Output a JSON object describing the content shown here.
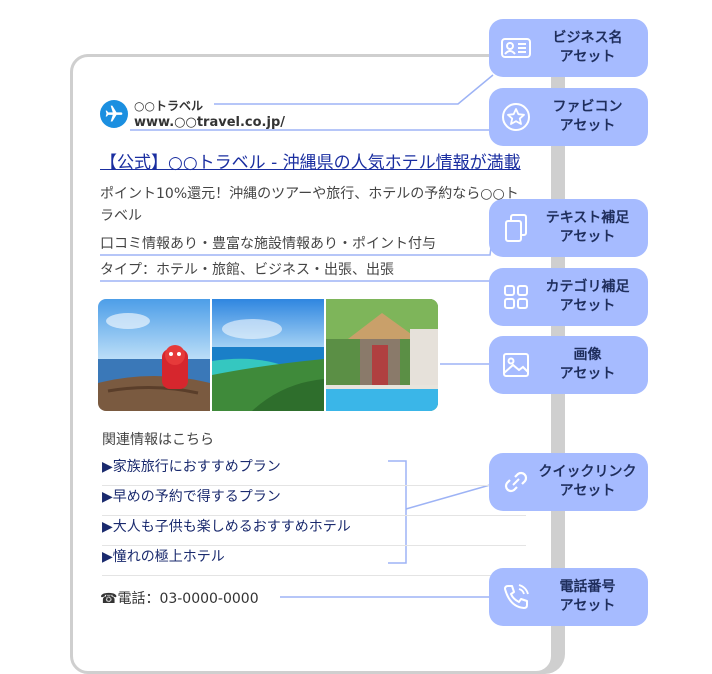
{
  "ad": {
    "business_name": "○○トラベル",
    "url": "www.○○travel.co.jp/",
    "headline": "【公式】○○トラベル - 沖縄県の人気ホテル情報が満載",
    "description": "ポイント10%還元！沖縄のツアーや旅行、ホテルの予約なら○○トラベル",
    "text_extension": "口コミ情報あり・豊富な施設情報あり・ポイント付与",
    "category_extension": "タイプ：ホテル・旅館、ビジネス・出張、出張",
    "related_heading": "関連情報はこちら",
    "quick_links": [
      "▶家族旅行におすすめプラン",
      "▶早めの予約で得するプラン",
      "▶大人も子供も楽しめるおすすめホテル",
      "▶憧れの極上ホテル"
    ],
    "phone": "☎電話：03-0000-0000"
  },
  "assets": [
    {
      "label": "ビジネス名\nアセット",
      "icon": "id-card-icon"
    },
    {
      "label": "ファビコン\nアセット",
      "icon": "star-icon"
    },
    {
      "label": "テキスト補足\nアセット",
      "icon": "copy-icon"
    },
    {
      "label": "カテゴリ補足\nアセット",
      "icon": "grid-icon"
    },
    {
      "label": "画像\nアセット",
      "icon": "image-icon"
    },
    {
      "label": "クイックリンク\nアセット",
      "icon": "link-icon"
    },
    {
      "label": "電話番号\nアセット",
      "icon": "phone-icon"
    }
  ],
  "colors": {
    "badge": "#a6bbff",
    "connector": "#9db3f5",
    "link_text": "#1a2ea0",
    "favicon": "#1b8fe0"
  }
}
